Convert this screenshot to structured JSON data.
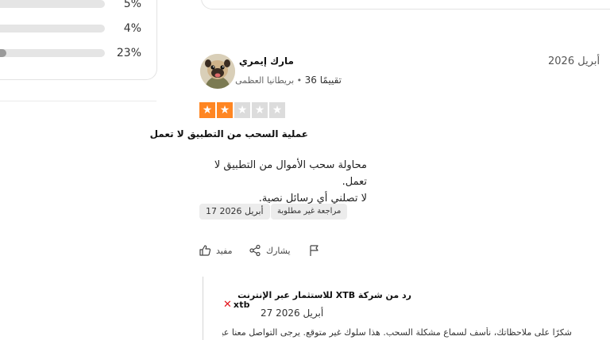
{
  "distribution": {
    "rows": [
      {
        "percent_label": "5%",
        "fill": 0.0
      },
      {
        "percent_label": "4%",
        "fill": 0.0
      },
      {
        "percent_label": "23%",
        "fill": 0.06
      }
    ],
    "fill_color": "#9a9a9a",
    "track_color": "#e5e5e5"
  },
  "review": {
    "date": "2026 أبريل",
    "reviewer": {
      "name": "مارك إيمري",
      "review_count": "تقييمًا 36",
      "separator": "•",
      "country": "بريطانيا العظمى"
    },
    "rating": 2,
    "rating_max": 5,
    "star_color": "#ff8622",
    "title": "عملية السحب من التطبيق لا تعمل",
    "body_lines": [
      "محاولة سحب الأموال من التطبيق لا تعمل.",
      "لا تصلني أي رسائل نصية."
    ],
    "experience_date": "17 أبريل 2026",
    "review_type": "مراجعة غير مطلوبة",
    "actions": {
      "helpful": "مفيد",
      "share": "يشارك"
    },
    "reply": {
      "company_logo_text": "xtb",
      "title": "رد من شركة XTB للاستثمار عبر الإنترنت",
      "date": "27 أبريل 2026",
      "body": "شكرًا على ملاحظاتك، نأسف لسماع مشكلة السحب. هذا سلوك غير متوقع. يرجى التواصل معنا عبر البريد"
    }
  }
}
